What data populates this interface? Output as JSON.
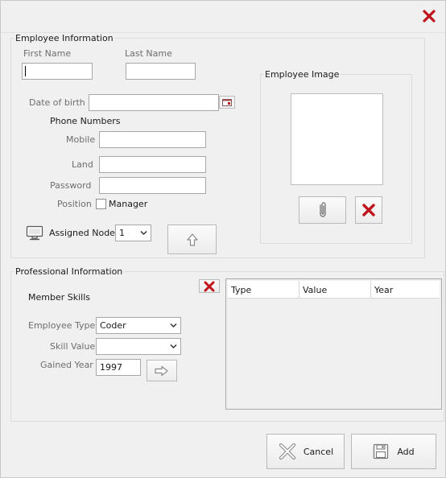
{
  "employee_info": {
    "legend": "Employee Information",
    "first_name_label": "First Name",
    "first_name_value": "",
    "last_name_label": "Last Name",
    "last_name_value": "",
    "dob_label": "Date of birth",
    "dob_value": "",
    "phone_numbers_heading": "Phone Numbers",
    "mobile_label": "Mobile",
    "mobile_value": "",
    "land_label": "Land",
    "land_value": "",
    "password_label": "Password",
    "password_value": "",
    "position_label": "Position",
    "manager_label": "Manager",
    "manager_checked": false,
    "assigned_node_label": "Assigned Node",
    "assigned_node_value": "1",
    "image_legend": "Employee Image"
  },
  "professional_info": {
    "legend": "Professional Information",
    "member_skills_heading": "Member Skills",
    "employee_type_label": "Employee Type",
    "employee_type_value": "Coder",
    "skill_value_label": "Skill Value",
    "skill_value_value": "",
    "gained_year_label": "Gained Year",
    "gained_year_value": "1997",
    "table_columns": [
      "Type",
      "Value",
      "Year"
    ],
    "table_rows": []
  },
  "footer": {
    "cancel_label": "Cancel",
    "add_label": "Add"
  },
  "colors": {
    "accent_red": "#c0141c",
    "icon_gray": "#8a8a8a"
  },
  "icons": {
    "close": "close-icon",
    "calendar": "calendar-icon",
    "computer": "computer-icon",
    "upload": "arrow-up-icon",
    "attach": "paperclip-icon",
    "remove": "delete-x-icon",
    "add_skill": "arrow-right-icon",
    "cancel": "cancel-x-icon",
    "add": "floppy-icon"
  }
}
